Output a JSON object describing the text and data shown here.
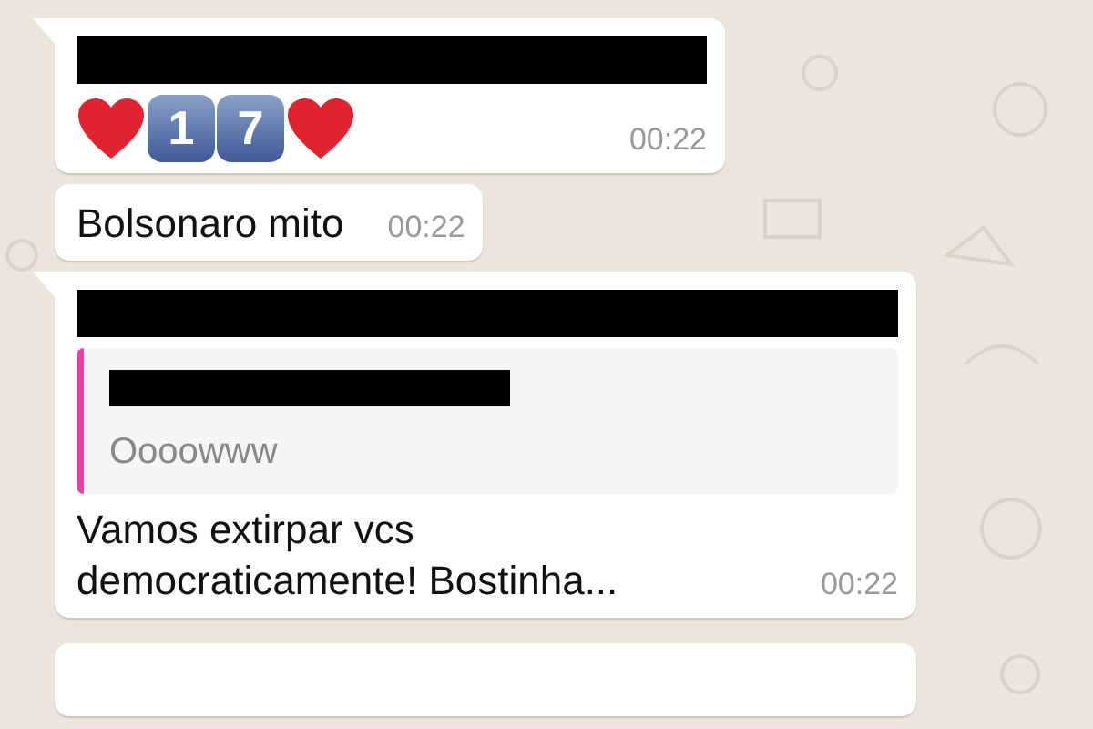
{
  "messages": [
    {
      "kind": "emoji",
      "sender_redacted": true,
      "emoji": [
        {
          "kind": "heart"
        },
        {
          "kind": "keycap",
          "label": "1"
        },
        {
          "kind": "keycap",
          "label": "7"
        },
        {
          "kind": "heart"
        }
      ],
      "time": "00:22",
      "tail": true
    },
    {
      "kind": "text",
      "sender_redacted": false,
      "text": "Bolsonaro mito",
      "time": "00:22",
      "tail": false
    },
    {
      "kind": "reply",
      "sender_redacted": true,
      "quote": {
        "sender_redacted": true,
        "text": "Oooowww",
        "color": "#e542a3"
      },
      "text": "Vamos extirpar vcs democraticamente! Bostinha...",
      "time": "00:22",
      "tail": true
    }
  ]
}
